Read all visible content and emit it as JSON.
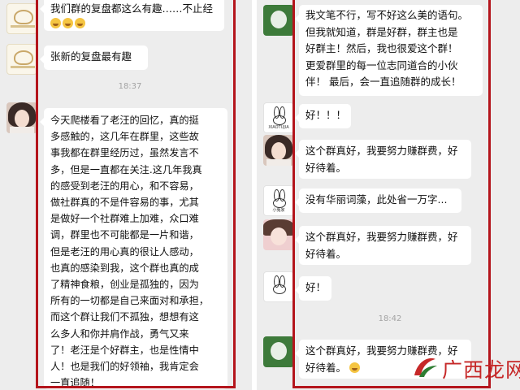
{
  "left_chat": {
    "msg1_line1": "我们群的复盘都这么有趣……不止经",
    "msg2": "张新的复盘最有趣",
    "timestamp": "18:37",
    "msg3_lines": [
      "今天爬楼看了老汪的回忆，真的挺",
      "多感触的，这几年在群里，这些故",
      "事我都在群里经历过，虽然发言不",
      "多，但是一直都在关注.这几年我真",
      "的感受到老汪的用心，和不容易，",
      "做社群真的不是件容易的事，尤其",
      "是做好一个社群难上加难，众口难",
      "调，群里也不可能都是一片和谐，",
      "但是老汪的用心真的很让人感动，",
      "也真的感染到我，这个群也真的成",
      "了精神食粮，创业是孤独的，因为",
      "所有的一切都是自己来面对和承担，",
      "而这个群让我们不孤独，想想有这",
      "么多人和你并肩作战，勇气又来",
      "了！老汪是个好群主，也是性情中",
      "人！也是我们的好领袖，我肯定会",
      "一直追随！"
    ]
  },
  "right_chat": {
    "msg1_lines": [
      "我文笔不行，写不好这么美的语句。",
      "但我就知道，群是好群，群主也是",
      "好群主！然后，我也很爱这个群！",
      "更爱群里的每一位志同道合的小伙",
      "伴！ 最后，会一直追随群的成长！"
    ],
    "msg2": "好！！！",
    "msg3_lines": [
      "这个群真好，我要努力赚群费，好",
      "好待着。"
    ],
    "msg4": "没有华丽词藻，此处省一万字...",
    "msg5_lines": [
      "这个群真好，我要努力赚群费，好",
      "好待着。"
    ],
    "msg6": "好！",
    "timestamp": "18:42",
    "msg7_lines": [
      "这个群真好，我要努力赚群费，好",
      "好待着。"
    ],
    "rabbit_label_top": "XIAOTUJIA",
    "rabbit_label_bottom": "小兔家"
  },
  "watermark": {
    "text": "广西龙网"
  },
  "colors": {
    "frame": "#b4151c",
    "chat_bg": "#ededed",
    "bubble": "#ffffff",
    "watermark": "#c62828"
  },
  "icons": [
    "group-logo-avatar",
    "girl-avatar",
    "flower-avatar",
    "rabbit-avatar",
    "pink-girl-avatar",
    "emoji-icon",
    "watermark-logo-icon"
  ]
}
